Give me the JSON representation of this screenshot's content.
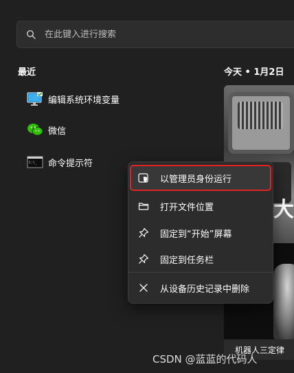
{
  "search": {
    "placeholder": "在此键入进行搜索",
    "icon": "search-icon"
  },
  "recent": {
    "title": "最近",
    "items": [
      {
        "label": "编辑系统环境变量",
        "icon": "monitor-settings-icon"
      },
      {
        "label": "微信",
        "icon": "wechat-icon"
      },
      {
        "label": "命令提示符",
        "icon": "terminal-icon"
      }
    ]
  },
  "news": {
    "date_header": "今天 • 1月2日",
    "headline_fragment": "大",
    "caption": "机器人三定律"
  },
  "context_menu": {
    "items": [
      {
        "label": "以管理员身份运行",
        "icon": "shield-window-icon",
        "highlighted": true
      },
      {
        "label": "打开文件位置",
        "icon": "folder-icon"
      },
      {
        "label": "固定到“开始”屏幕",
        "icon": "pin-icon"
      },
      {
        "label": "固定到任务栏",
        "icon": "pin-icon"
      },
      {
        "label": "从设备历史记录中删除",
        "icon": "close-icon"
      }
    ],
    "highlight_color": "#e02424"
  },
  "watermark": "CSDN @蓝蓝的代码人",
  "colors": {
    "background": "#202020",
    "menu_background": "#2c2c2c",
    "search_background": "#2d2d2d"
  }
}
